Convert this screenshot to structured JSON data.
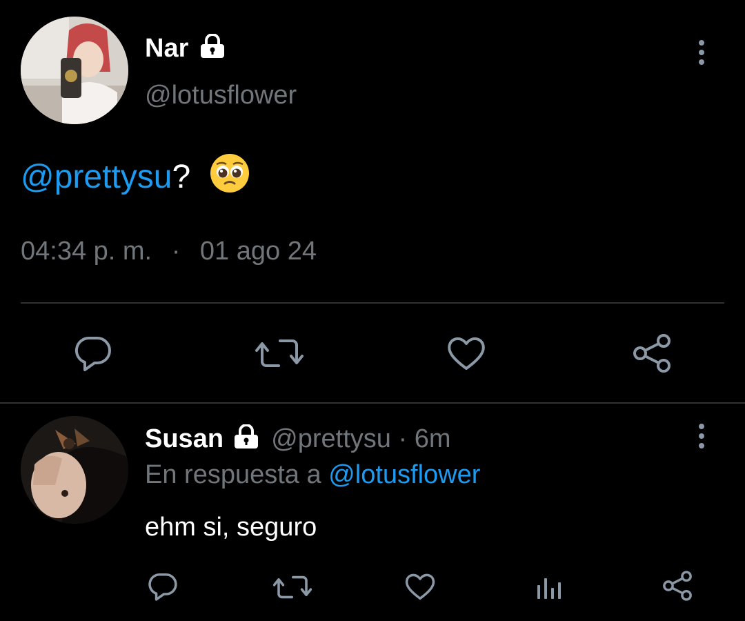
{
  "tweet": {
    "author_name": "Nar",
    "author_handle": "@lotusflower",
    "mention": "@prettysu",
    "text_suffix": "?",
    "emoji": "🥺",
    "time": "04:34 p. m.",
    "separator": "·",
    "date": "01 ago 24"
  },
  "reply": {
    "author_name": "Susan",
    "author_handle": "@prettysu",
    "separator": "·",
    "age": "6m",
    "replying_to_label": "En respuesta a",
    "replying_to_handle": "@lotusflower",
    "text": "ehm si, seguro"
  },
  "colors": {
    "background": "#000000",
    "text": "#ffffff",
    "muted": "#71767b",
    "link": "#1d9bf0",
    "divider": "#2f3336"
  },
  "icons": [
    "lock-icon",
    "more-options-icon",
    "reply-icon",
    "retweet-icon",
    "like-icon",
    "share-icon",
    "analytics-icon"
  ]
}
